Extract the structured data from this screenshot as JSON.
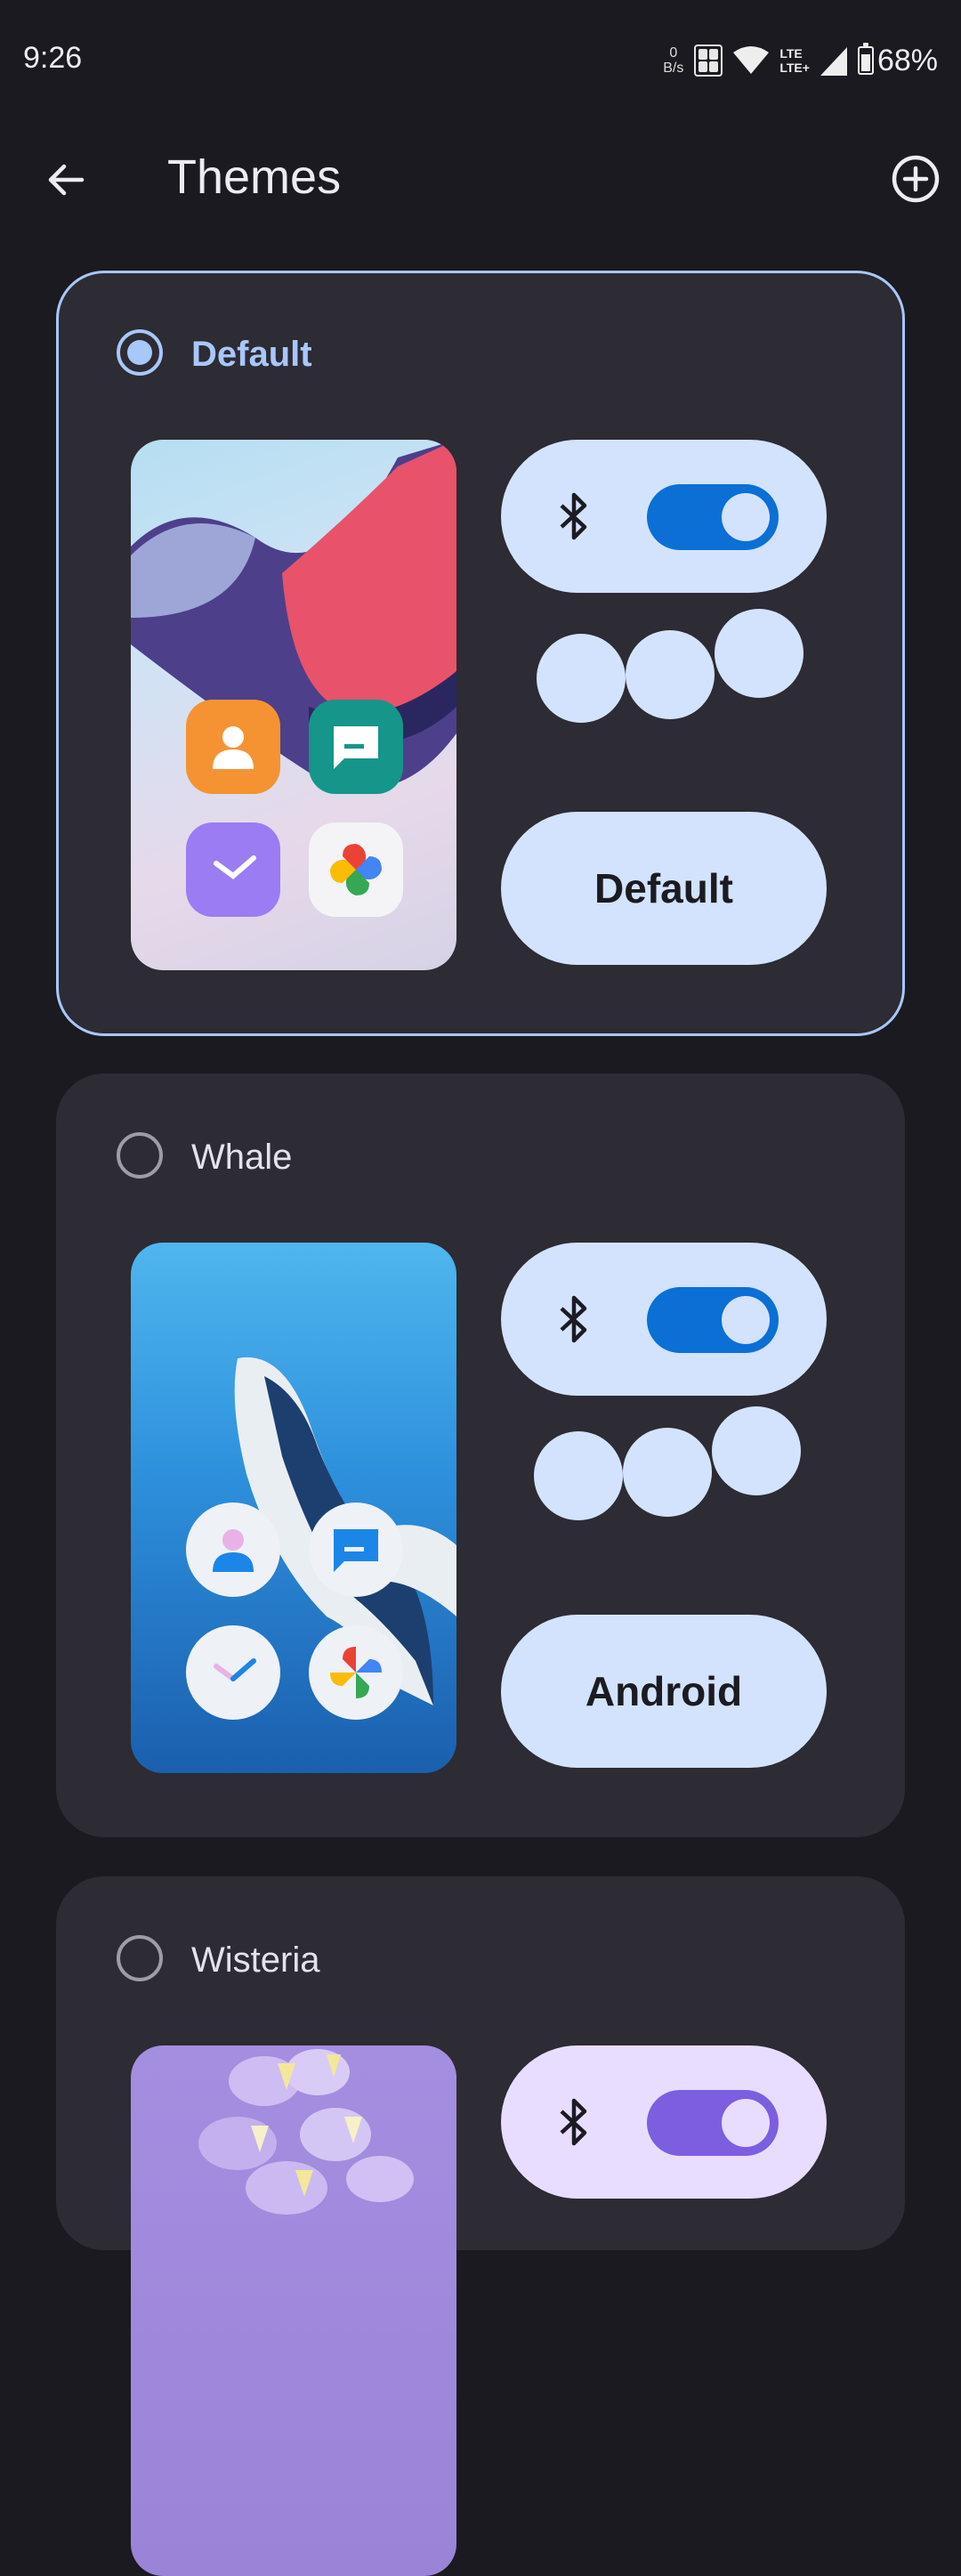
{
  "status_bar": {
    "time": "9:26",
    "net_speed_value": "0",
    "net_speed_unit": "B/s",
    "lte_top": "LTE",
    "lte_bottom": "LTE+",
    "battery": "68%"
  },
  "app_bar": {
    "title": "Themes",
    "back_icon": "arrow-back-icon",
    "add_icon": "add-circle-icon"
  },
  "themes": [
    {
      "name": "Default",
      "selected": true,
      "label": "Default",
      "accent": "#a8c7fa",
      "pill_color": "#d3e3fd",
      "toggle_color": "#0b6fd6"
    },
    {
      "name": "Whale",
      "selected": false,
      "label": "Android",
      "accent": "#a8c7fa",
      "pill_color": "#d3e3fd",
      "toggle_color": "#0b6fd6"
    },
    {
      "name": "Wisteria",
      "selected": false,
      "label": "",
      "accent": "#d0bcff",
      "pill_color": "#e9ddff",
      "toggle_color": "#7c5fe0"
    }
  ]
}
